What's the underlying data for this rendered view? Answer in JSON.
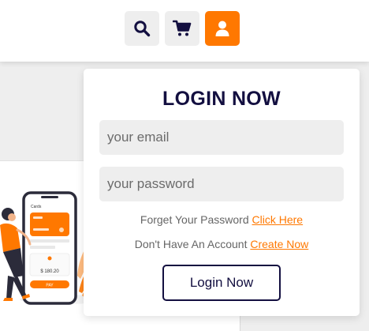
{
  "header": {
    "icons": {
      "search": "search-icon",
      "cart": "shopping-cart-icon",
      "user": "user-icon"
    }
  },
  "colors": {
    "accent": "#ff7800",
    "navy": "#130f40",
    "light_bg": "#eeeeee"
  },
  "content_card": {
    "phone_screen": {
      "title": "Cards",
      "price": "$ 180.20",
      "pay_label": "PAY"
    }
  },
  "login_form": {
    "title": "LOGIN NOW",
    "email_placeholder": "your email",
    "password_placeholder": "your password",
    "forget_text": "Forget Your Password ",
    "forget_link": "Click Here",
    "account_text": "Don't Have An Account ",
    "account_link": "Create Now",
    "submit_label": "Login Now"
  }
}
